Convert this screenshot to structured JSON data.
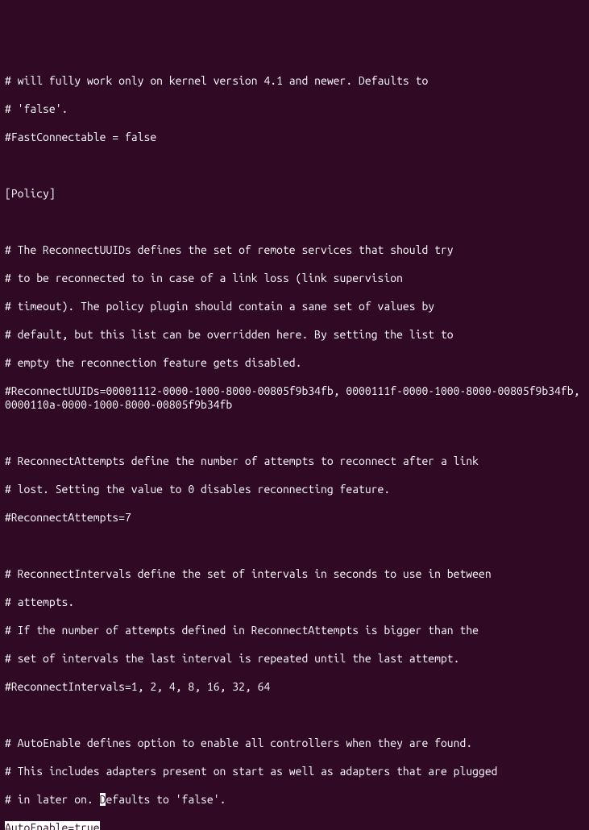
{
  "lines": {
    "l0": "# will fully work only on kernel version 4.1 and newer. Defaults to",
    "l1": "# 'false'.",
    "l2": "#FastConnectable = false",
    "l3": "",
    "l4": "[Policy]",
    "l5": "",
    "l6": "# The ReconnectUUIDs defines the set of remote services that should try",
    "l7": "# to be reconnected to in case of a link loss (link supervision",
    "l8": "# timeout). The policy plugin should contain a sane set of values by",
    "l9": "# default, but this list can be overridden here. By setting the list to",
    "l10": "# empty the reconnection feature gets disabled.",
    "l11": "#ReconnectUUIDs=00001112-0000-1000-8000-00805f9b34fb, 0000111f-0000-1000-8000-00805f9b34fb, 0000110a-0000-1000-8000-00805f9b34fb",
    "l12": "",
    "l13": "# ReconnectAttempts define the number of attempts to reconnect after a link",
    "l14": "# lost. Setting the value to 0 disables reconnecting feature.",
    "l15": "#ReconnectAttempts=7",
    "l16": "",
    "l17": "# ReconnectIntervals define the set of intervals in seconds to use in between",
    "l18": "# attempts.",
    "l19": "# If the number of attempts defined in ReconnectAttempts is bigger than the",
    "l20": "# set of intervals the last interval is repeated until the last attempt.",
    "l21": "#ReconnectIntervals=1, 2, 4, 8, 16, 32, 64",
    "l22": "",
    "l23": "# AutoEnable defines option to enable all controllers when they are found.",
    "l24": "# This includes adapters present on start as well as adapters that are plugged",
    "l25a": "# in later on. ",
    "l25b": "D",
    "l25c": "efaults to 'false'.",
    "l26": "AutoEnable=true"
  }
}
